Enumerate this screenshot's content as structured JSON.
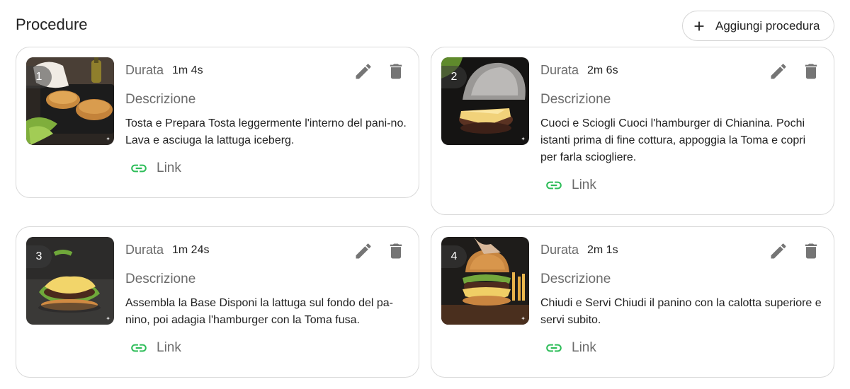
{
  "header": {
    "title": "Procedure",
    "add_button_label": "Aggiungi procedura"
  },
  "accent_colors": {
    "link_icon": "#2ebd59",
    "icon_gray": "#757575"
  },
  "steps": [
    {
      "number": "1",
      "duration_label": "Durata",
      "duration_value": "1m 4s",
      "description_label": "Descrizione",
      "description": "Tosta e Prepara Tosta leggermente l'interno del pani-no. Lava e asciuga la lattuga iceberg.",
      "link_label": "Link",
      "image_icon": "toasting-buns-photo"
    },
    {
      "number": "2",
      "duration_label": "Durata",
      "duration_value": "2m 6s",
      "description_label": "Descrizione",
      "description": "Cuoci e Sciogli Cuoci l'hamburger di Chianina. Pochi istanti prima di fine cottura, appoggia la Toma e copri per farla sciogliere.",
      "link_label": "Link",
      "image_icon": "melting-cheese-photo"
    },
    {
      "number": "3",
      "duration_label": "Durata",
      "duration_value": "1m 24s",
      "description_label": "Descrizione",
      "description": "Assembla la Base Disponi la lattuga sul fondo del pa-nino, poi adagia l'hamburger con la Toma fusa.",
      "link_label": "Link",
      "image_icon": "assembled-base-photo"
    },
    {
      "number": "4",
      "duration_label": "Durata",
      "duration_value": "2m 1s",
      "description_label": "Descrizione",
      "description": "Chiudi e Servi Chiudi il panino con la calotta superiore e servi subito.",
      "link_label": "Link",
      "image_icon": "finished-burger-photo"
    }
  ]
}
